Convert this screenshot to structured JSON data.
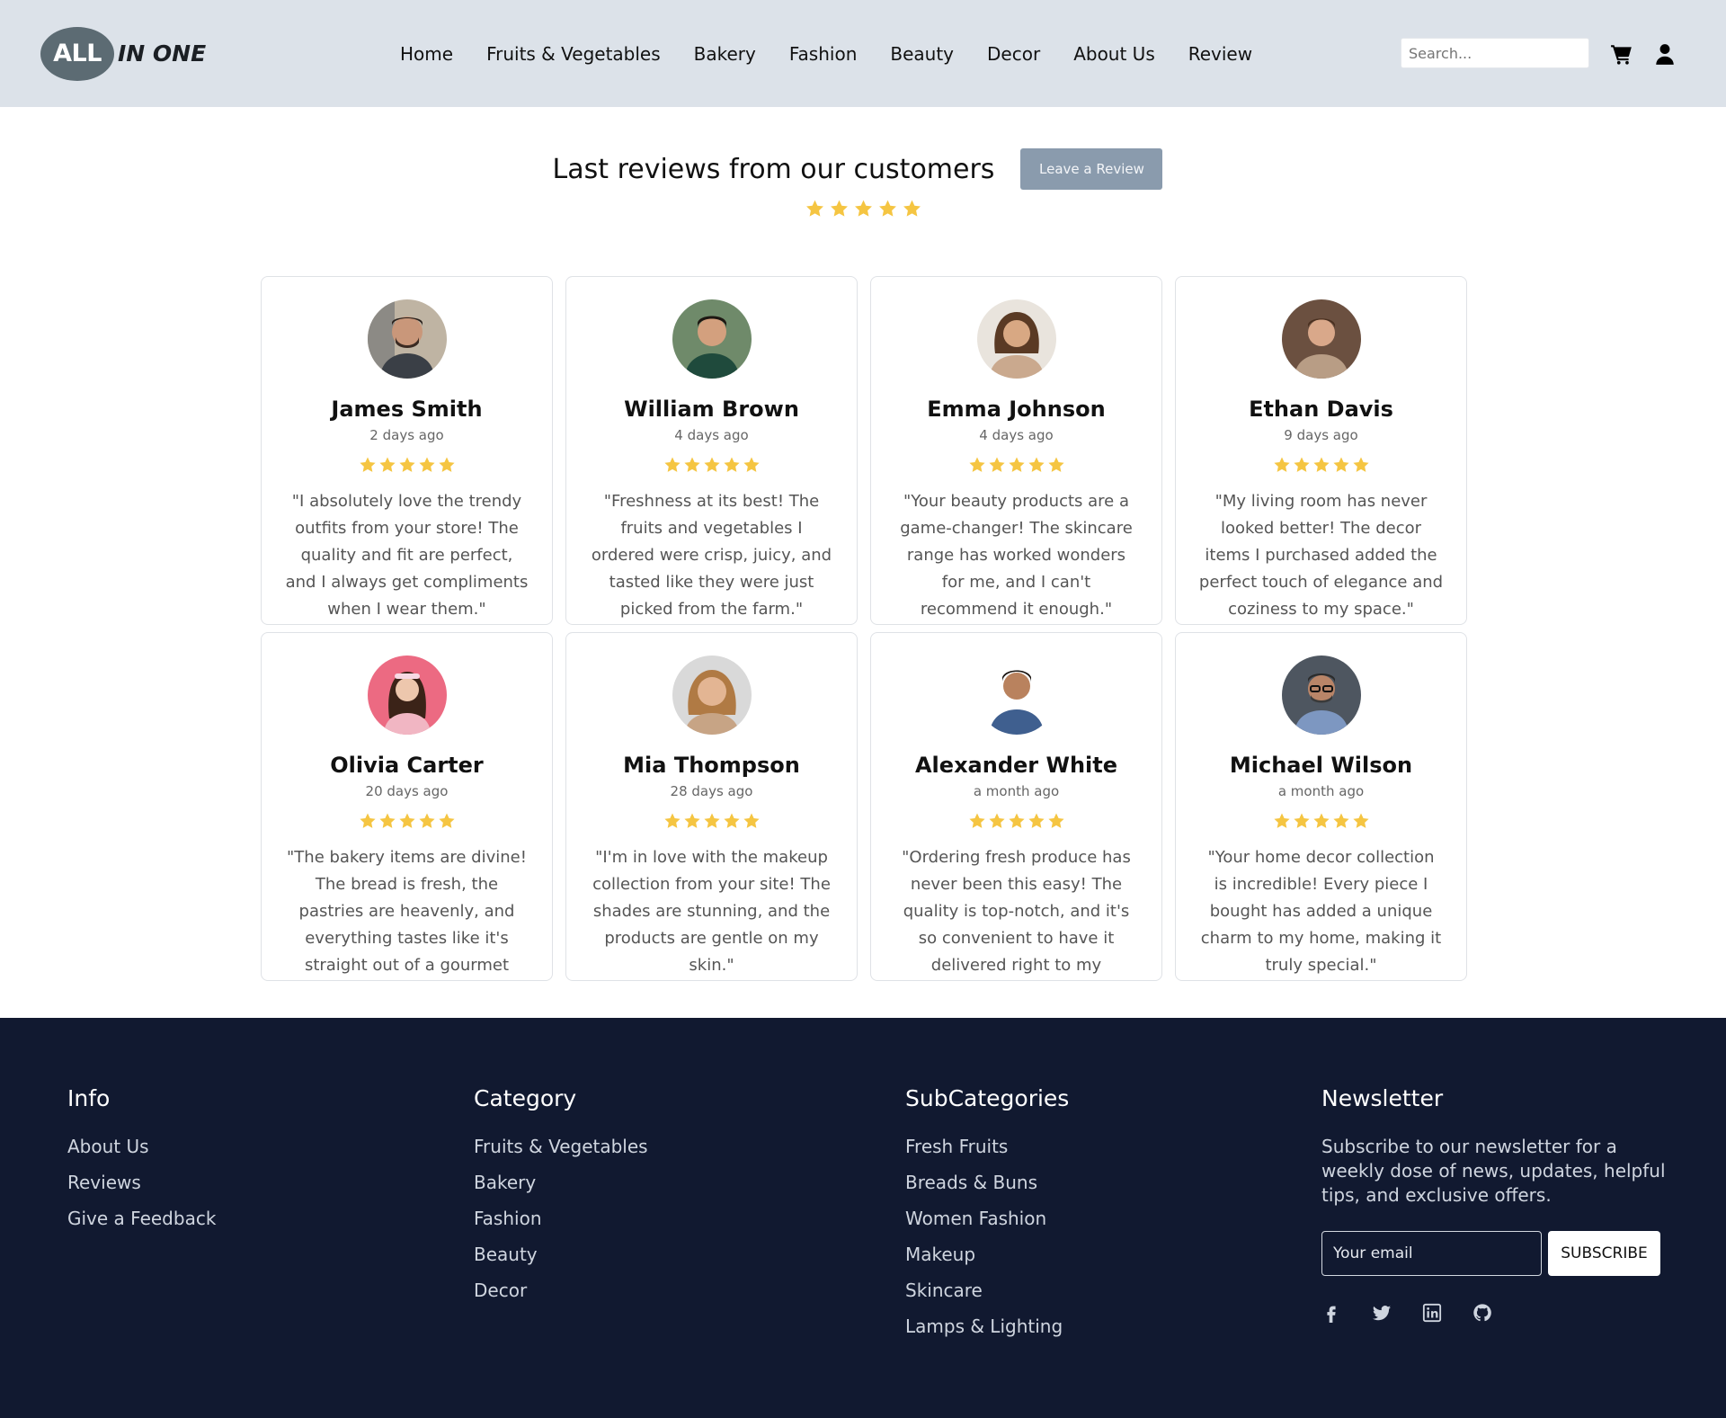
{
  "header": {
    "logo": {
      "part1": "ALL",
      "part2": "IN ONE"
    },
    "nav": [
      "Home",
      "Fruits & Vegetables",
      "Bakery",
      "Fashion",
      "Beauty",
      "Decor",
      "About Us",
      "Review"
    ],
    "search_placeholder": "Search...",
    "icons": [
      "cart-icon",
      "user-icon"
    ]
  },
  "reviews_section": {
    "title": "Last reviews from our customers",
    "leave_review_label": "Leave a Review",
    "rating": 5
  },
  "reviews": [
    {
      "name": "James Smith",
      "time": "2 days ago",
      "rating": 5,
      "quote": "\"I absolutely love the trendy outfits from your store! The quality and fit are perfect, and I always get compliments when I wear them.\""
    },
    {
      "name": "William Brown",
      "time": "4 days ago",
      "rating": 5,
      "quote": "\"Freshness at its best! The fruits and vegetables I ordered were crisp, juicy, and tasted like they were just picked from the farm.\""
    },
    {
      "name": "Emma Johnson",
      "time": "4 days ago",
      "rating": 5,
      "quote": "\"Your beauty products are a game-changer! The skincare range has worked wonders for me, and I can't recommend it enough.\""
    },
    {
      "name": "Ethan Davis",
      "time": "9 days ago",
      "rating": 5,
      "quote": "\"My living room has never looked better! The decor items I purchased added the perfect touch of elegance and coziness to my space.\""
    },
    {
      "name": "Olivia Carter",
      "time": "20 days ago",
      "rating": 5,
      "quote": "\"The bakery items are divine! The bread is fresh, the pastries are heavenly, and everything tastes like it's straight out of a gourmet kitchen.\""
    },
    {
      "name": "Mia Thompson",
      "time": "28 days ago",
      "rating": 5,
      "quote": "\"I'm in love with the makeup collection from your site! The shades are stunning, and the products are gentle on my skin.\""
    },
    {
      "name": "Alexander White",
      "time": "a month ago",
      "rating": 5,
      "quote": "\"Ordering fresh produce has never been this easy! The quality is top-notch, and it's so convenient to have it delivered right to my doorstep.\""
    },
    {
      "name": "Michael Wilson",
      "time": "a month ago",
      "rating": 5,
      "quote": "\"Your home decor collection is incredible! Every piece I bought has added a unique charm to my home, making it truly special.\""
    }
  ],
  "footer": {
    "info": {
      "title": "Info",
      "links": [
        "About Us",
        "Reviews",
        "Give a Feedback"
      ]
    },
    "category": {
      "title": "Category",
      "links": [
        "Fruits & Vegetables",
        "Bakery",
        "Fashion",
        "Beauty",
        "Decor"
      ]
    },
    "subcategories": {
      "title": "SubCategories",
      "links": [
        "Fresh Fruits",
        "Breads & Buns",
        "Women Fashion",
        "Makeup",
        "Skincare",
        "Lamps & Lighting"
      ]
    },
    "newsletter": {
      "title": "Newsletter",
      "text": "Subscribe to our newsletter for a weekly dose of news, updates, helpful tips, and exclusive offers.",
      "email_placeholder": "Your email",
      "subscribe_label": "SUBSCRIBE",
      "socials": [
        "facebook-icon",
        "twitter-icon",
        "linkedin-icon",
        "github-icon"
      ]
    }
  },
  "colors": {
    "header_bg": "#dce2e9",
    "star": "#f5c542",
    "button_bg": "#8a9bad",
    "footer_bg": "#111930"
  }
}
